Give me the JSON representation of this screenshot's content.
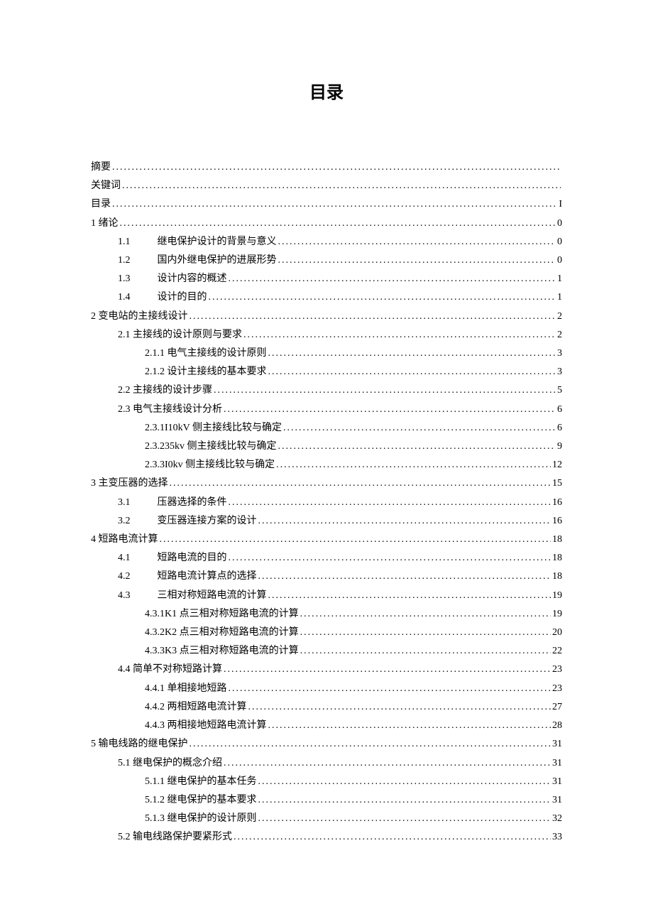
{
  "page_title": "目录",
  "toc": [
    {
      "level": 0,
      "label": "摘要",
      "page": ""
    },
    {
      "level": 0,
      "label": "关键词",
      "page": ""
    },
    {
      "level": 0,
      "label": "目录",
      "page": "I"
    },
    {
      "level": 0,
      "label": "1 绪论",
      "page": "0"
    },
    {
      "level": 1,
      "label": "1.1",
      "text": "继电保护设计的背景与意义",
      "page": "0",
      "num_gap": true
    },
    {
      "level": 1,
      "label": "1.2",
      "text": "国内外继电保护的进展形势",
      "page": "0",
      "num_gap": true
    },
    {
      "level": 1,
      "label": "1.3",
      "text": "设计内容的概述",
      "page": "1",
      "num_gap": true
    },
    {
      "level": 1,
      "label": "1.4",
      "text": "设计的目的",
      "page": "1",
      "num_gap": true
    },
    {
      "level": 0,
      "label": "2 变电站的主接线设计",
      "page": "2"
    },
    {
      "level": 1,
      "label": "2.1 主接线的设计原则与要求",
      "page": "2"
    },
    {
      "level": 2,
      "label": "2.1.1 电气主接线的设计原则",
      "page": "3"
    },
    {
      "level": 2,
      "label": "2.1.2 设计主接线的基本要求",
      "page": "3"
    },
    {
      "level": 1,
      "label": "2.2 主接线的设计步骤",
      "page": "5"
    },
    {
      "level": 1,
      "label": "2.3 电气主接线设计分析",
      "page": "6"
    },
    {
      "level": 2,
      "label": "2.3.1I10kV 侧主接线比较与确定",
      "page": "6"
    },
    {
      "level": 2,
      "label": "2.3.235kv 侧主接线比较与确定",
      "page": "9"
    },
    {
      "level": 2,
      "label": "2.3.3I0kv 侧主接线比较与确定",
      "page": "12"
    },
    {
      "level": 0,
      "label": "3 主变压器的选择",
      "page": "15"
    },
    {
      "level": 1,
      "label": "3.1",
      "text": "压器选择的条件",
      "page": "16",
      "num_gap": true
    },
    {
      "level": 1,
      "label": "3.2",
      "text": "变压器连接方案的设计",
      "page": "16",
      "num_gap": true
    },
    {
      "level": 0,
      "label": "4 短路电流计算",
      "page": "18"
    },
    {
      "level": 1,
      "label": "4.1",
      "text": "短路电流的目的",
      "page": "18",
      "num_gap": true
    },
    {
      "level": 1,
      "label": "4.2",
      "text": "短路电流计算点的选择",
      "page": "18",
      "num_gap": true
    },
    {
      "level": 1,
      "label": "4.3",
      "text": "三相对称短路电流的计算",
      "page": "19",
      "num_gap": true
    },
    {
      "level": 2,
      "label": "4.3.1K1 点三相对称短路电流的计算",
      "page": "19"
    },
    {
      "level": 2,
      "label": "4.3.2K2 点三相对称短路电流的计算",
      "page": "20"
    },
    {
      "level": 2,
      "label": "4.3.3K3 点三相对称短路电流的计算",
      "page": "22"
    },
    {
      "level": 1,
      "label": "4.4 简单不对称短路计算",
      "page": "23"
    },
    {
      "level": 2,
      "label": "4.4.1 单相接地短路",
      "page": "23"
    },
    {
      "level": 2,
      "label": "4.4.2 两相短路电流计算",
      "page": "27"
    },
    {
      "level": 2,
      "label": "4.4.3 两相接地短路电流计算",
      "page": "28"
    },
    {
      "level": 0,
      "label": "5 输电线路的继电保护",
      "page": "31"
    },
    {
      "level": 1,
      "label": "5.1 继电保护的概念介绍",
      "page": "31"
    },
    {
      "level": 2,
      "label": "5.1.1 继电保护的基本任务",
      "page": "31"
    },
    {
      "level": 2,
      "label": "5.1.2 继电保护的基本要求",
      "page": "31"
    },
    {
      "level": 2,
      "label": "5.1.3 继电保护的设计原则",
      "page": "32"
    },
    {
      "level": 1,
      "label": "5.2 输电线路保护要紧形式",
      "page": "33"
    }
  ]
}
